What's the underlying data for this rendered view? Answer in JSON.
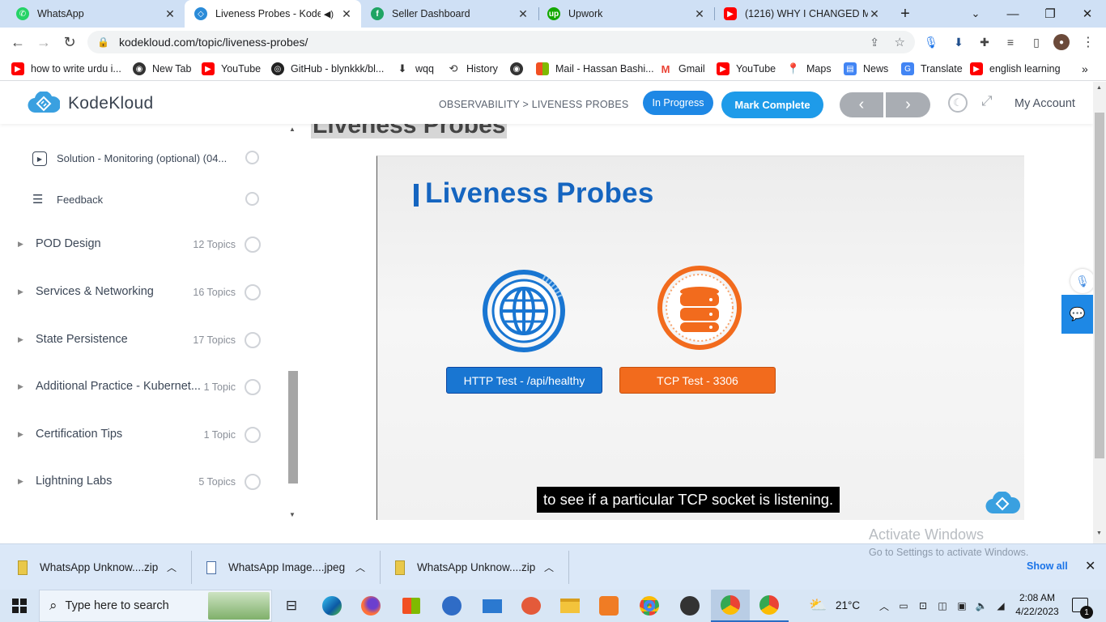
{
  "browser": {
    "tabs": [
      {
        "label": "WhatsApp",
        "icon": "whatsapp-icon",
        "color": "#25d366"
      },
      {
        "label": "Liveness Probes - KodeK",
        "icon": "kodekloud-icon",
        "color": "#2a8bd8",
        "audio": true
      },
      {
        "label": "Seller Dashboard",
        "icon": "seller-icon",
        "color": "#1fa463"
      },
      {
        "label": "Upwork",
        "icon": "upwork-icon",
        "color": "#14a800"
      },
      {
        "label": "(1216) WHY I CHANGED MY",
        "icon": "youtube-icon",
        "color": "#ff0000"
      }
    ],
    "url": "kodekloud.com/topic/liveness-probes/",
    "bookmarks": [
      {
        "label": "how to write urdu i...",
        "icon": "youtube-icon",
        "color": "#ff0000"
      },
      {
        "label": "New Tab",
        "icon": "globe-icon",
        "color": "#333333"
      },
      {
        "label": "YouTube",
        "icon": "youtube-icon",
        "color": "#ff0000"
      },
      {
        "label": "GitHub - blynkkk/bl...",
        "icon": "github-icon",
        "color": "#222222"
      },
      {
        "label": "wqq",
        "icon": "download-icon",
        "color": "#333333"
      },
      {
        "label": "History",
        "icon": "history-icon",
        "color": "#333333"
      },
      {
        "label": "",
        "icon": "globe-icon",
        "color": "#333333"
      },
      {
        "label": "Mail - Hassan Bashi...",
        "icon": "microsoft-icon",
        "color": "#f25022"
      },
      {
        "label": "Gmail",
        "icon": "gmail-icon",
        "color": "#ea4335"
      },
      {
        "label": "YouTube",
        "icon": "youtube-icon",
        "color": "#ff0000"
      },
      {
        "label": "Maps",
        "icon": "maps-icon",
        "color": "#34a853"
      },
      {
        "label": "News",
        "icon": "news-icon",
        "color": "#4285f4"
      },
      {
        "label": "Translate",
        "icon": "translate-icon",
        "color": "#4285f4"
      },
      {
        "label": "english learning",
        "icon": "youtube-icon",
        "color": "#ff0000"
      }
    ]
  },
  "header": {
    "logo_text": "KodeKloud",
    "breadcrumb": "OBSERVABILITY > LIVENESS PROBES",
    "status_badge": "In Progress",
    "mark_complete": "Mark Complete",
    "prev": "‹",
    "next": "›",
    "account": "My Account"
  },
  "sidebar": {
    "lessons": [
      {
        "label": "Solution - Monitoring (optional) (04...",
        "icon": "play-icon"
      },
      {
        "label": "Feedback",
        "icon": "list-icon"
      }
    ],
    "sections": [
      {
        "label": "POD Design",
        "count": "12 Topics"
      },
      {
        "label": "Services & Networking",
        "count": "16 Topics"
      },
      {
        "label": "State Persistence",
        "count": "17 Topics"
      },
      {
        "label": "Additional Practice - Kubernet...",
        "count": "1 Topic"
      },
      {
        "label": "Certification Tips",
        "count": "1 Topic"
      },
      {
        "label": "Lightning Labs",
        "count": "5 Topics"
      }
    ]
  },
  "content": {
    "page_title": "Liveness Probes",
    "slide_title": "Liveness Probes",
    "http_test": "HTTP Test - /api/healthy",
    "tcp_test": "TCP Test - 3306",
    "caption": "to see if a particular TCP socket is listening.",
    "watermark_title": "Activate Windows",
    "watermark_sub": "Go to Settings to activate Windows."
  },
  "downloads": {
    "items": [
      {
        "label": "WhatsApp Unknow....zip",
        "icon": "zip-icon"
      },
      {
        "label": "WhatsApp Image....jpeg",
        "icon": "image-file-icon"
      },
      {
        "label": "WhatsApp Unknow....zip",
        "icon": "zip-icon"
      }
    ],
    "show_all": "Show all"
  },
  "taskbar": {
    "search_placeholder": "Type here to search",
    "temperature": "21°C",
    "time": "2:08 AM",
    "date": "4/22/2023",
    "notifications": "1"
  },
  "colors": {
    "accent": "#1e88e5",
    "tab_strip": "#cfe0f5",
    "http_blue": "#1976d2",
    "tcp_orange": "#f26b1d",
    "taskbar": "#d8e6f5"
  }
}
